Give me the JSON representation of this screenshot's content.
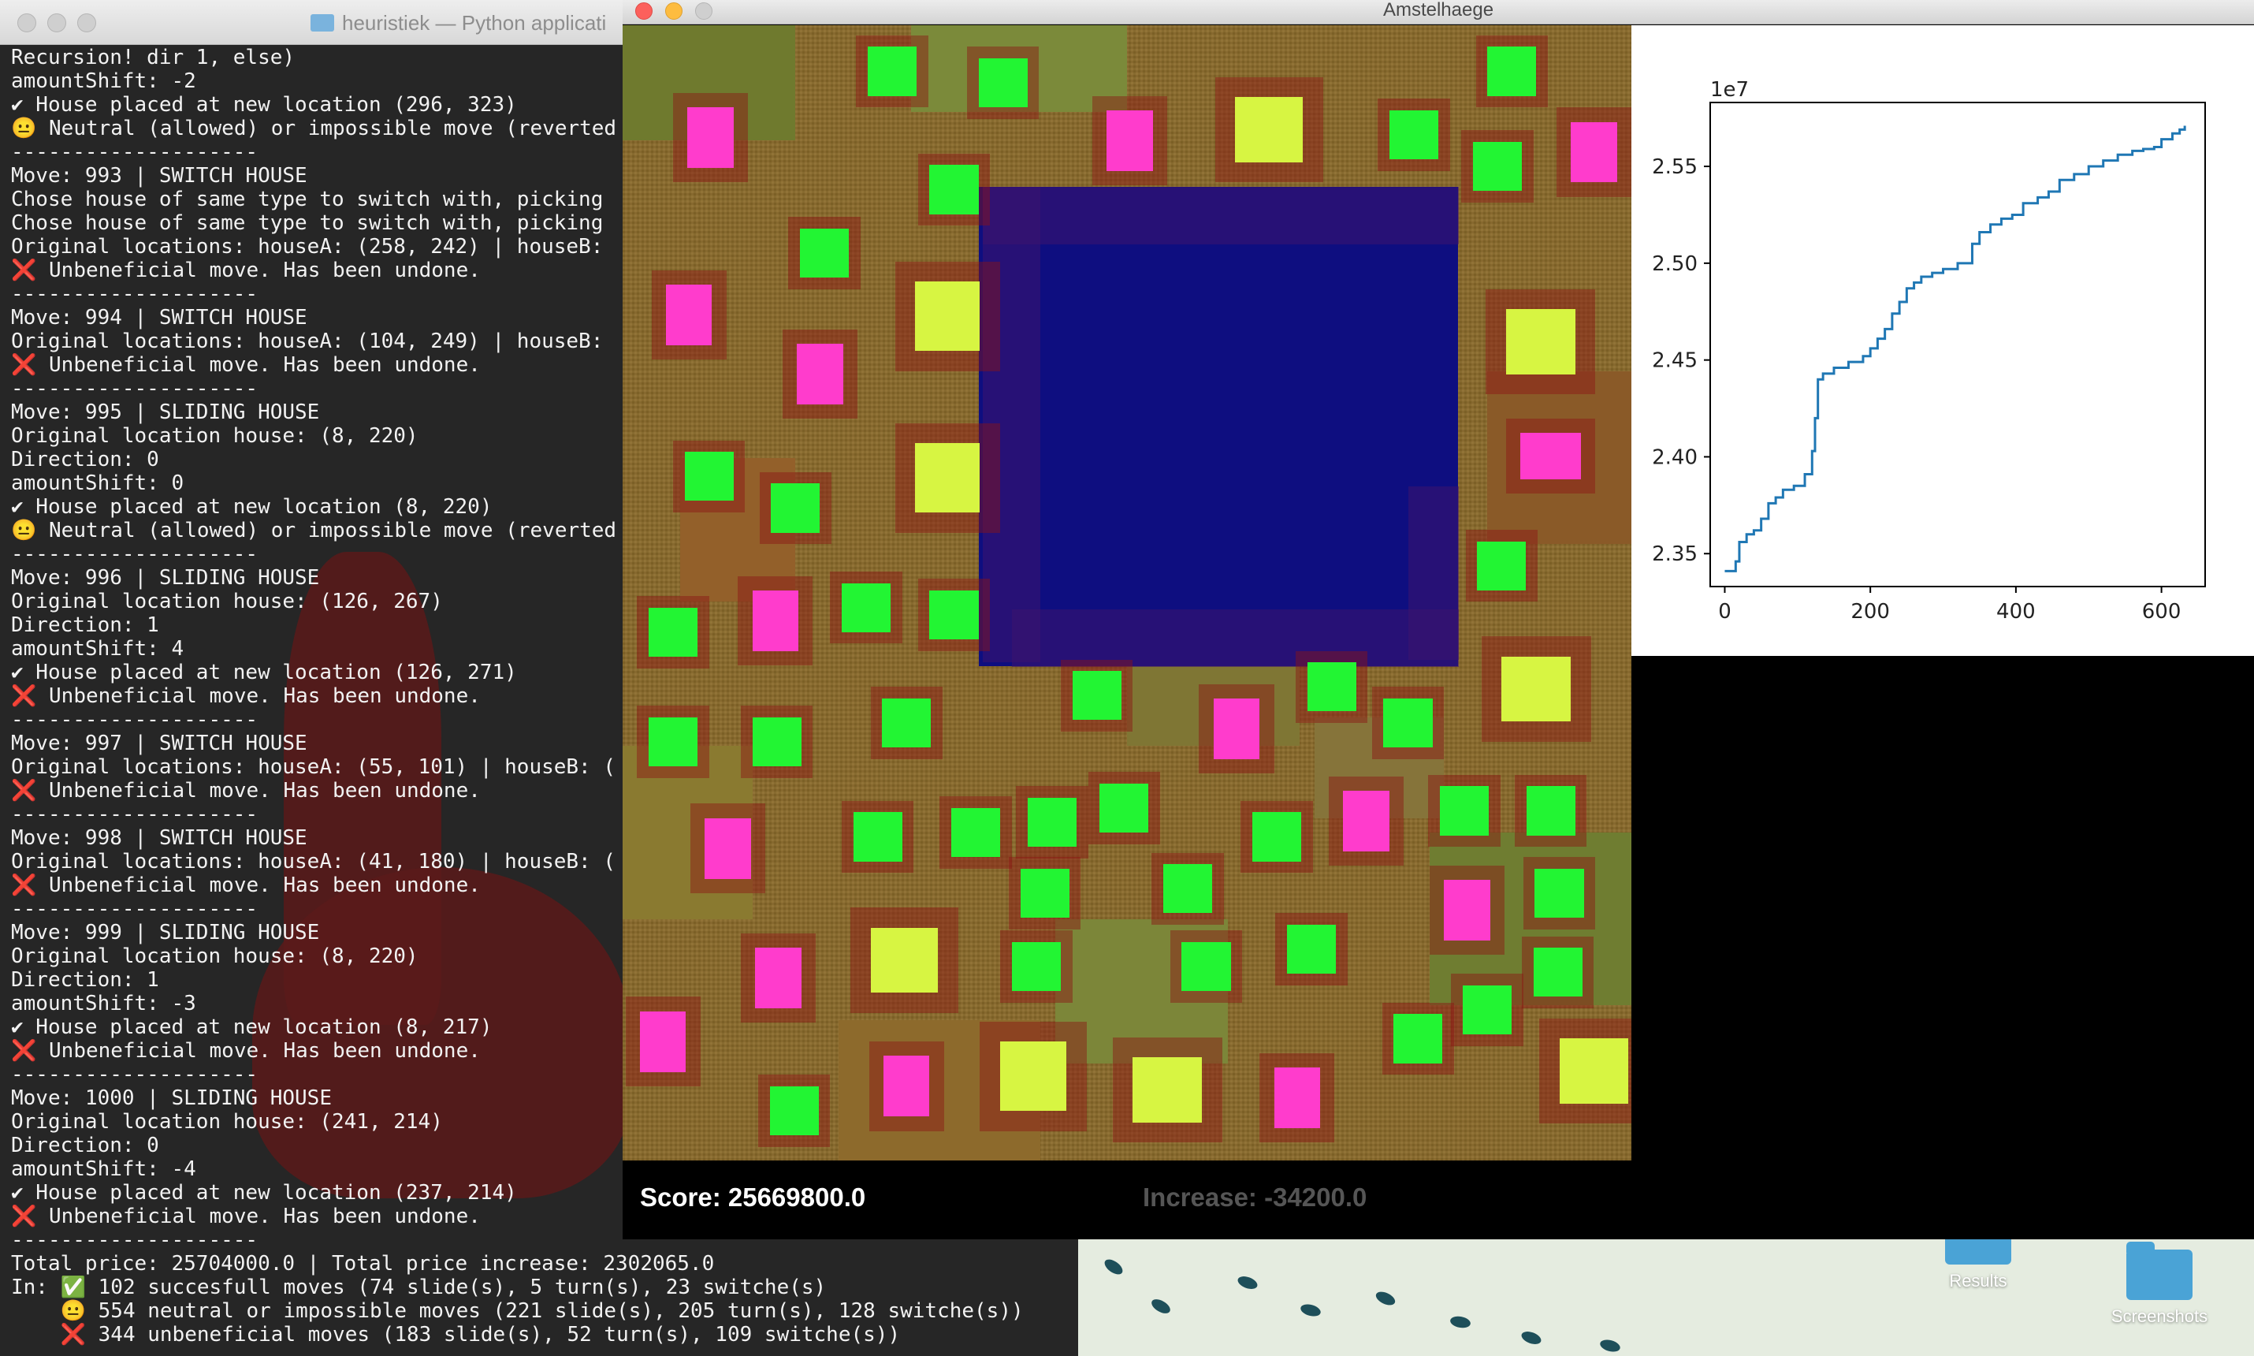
{
  "terminal": {
    "title": "heuristiek — Python applicati",
    "lines": [
      "Recursion! dir 1, else)",
      "amountShift: -2",
      "✔ House placed at new location (296, 323)",
      "😐 Neutral (allowed) or impossible move (reverted",
      "--------------------",
      "Move: 993 | SWITCH HOUSE",
      "Chose house of same type to switch with, picking",
      "Chose house of same type to switch with, picking",
      "Original locations: houseA: (258, 242) | houseB:",
      "❌ Unbeneficial move. Has been undone.",
      "--------------------",
      "Move: 994 | SWITCH HOUSE",
      "Original locations: houseA: (104, 249) | houseB:",
      "❌ Unbeneficial move. Has been undone.",
      "--------------------",
      "Move: 995 | SLIDING HOUSE",
      "Original location house: (8, 220)",
      "Direction: 0",
      "amountShift: 0",
      "✔ House placed at new location (8, 220)",
      "😐 Neutral (allowed) or impossible move (reverted",
      "--------------------",
      "Move: 996 | SLIDING HOUSE",
      "Original location house: (126, 267)",
      "Direction: 1",
      "amountShift: 4",
      "✔ House placed at new location (126, 271)",
      "❌ Unbeneficial move. Has been undone.",
      "--------------------",
      "Move: 997 | SWITCH HOUSE",
      "Original locations: houseA: (55, 101) | houseB: (",
      "❌ Unbeneficial move. Has been undone.",
      "--------------------",
      "Move: 998 | SWITCH HOUSE",
      "Original locations: houseA: (41, 180) | houseB: (",
      "❌ Unbeneficial move. Has been undone.",
      "--------------------",
      "Move: 999 | SLIDING HOUSE",
      "Original location house: (8, 220)",
      "Direction: 1",
      "amountShift: -3",
      "✔ House placed at new location (8, 217)",
      "❌ Unbeneficial move. Has been undone.",
      "--------------------",
      "Move: 1000 | SLIDING HOUSE",
      "Original location house: (241, 214)",
      "Direction: 0",
      "amountShift: -4",
      "✔ House placed at new location (237, 214)",
      "❌ Unbeneficial move. Has been undone.",
      "--------------------",
      "Total price: 25704000.0 | Total price increase: 2302065.0",
      "In: ✅ 102 succesfull moves (74 slide(s), 5 turn(s), 23 switche(s)",
      "    😐 554 neutral or impossible moves (221 slide(s), 205 turn(s), 128 switche(s))",
      "    ❌ 344 unbeneficial moves (183 slide(s), 52 turn(s), 109 switche(s))"
    ]
  },
  "game": {
    "title": "Amstelhaege",
    "score": "Score: 25669800.0",
    "increase": "Increase: -34200.0",
    "colors": {
      "single": "#22f533",
      "bungalow": "#ff3ccc",
      "maison": "#d7f542",
      "water": "#0e0e80"
    }
  },
  "desktop": {
    "icons": [
      {
        "label": "Results"
      },
      {
        "label": "Screenshots"
      }
    ]
  },
  "chart_data": {
    "type": "line",
    "offset_label": "1e7",
    "xlim": [
      -20,
      660
    ],
    "ylim": [
      2.333,
      2.583
    ],
    "xticks": [
      0,
      200,
      400,
      600
    ],
    "yticks": [
      2.35,
      2.4,
      2.45,
      2.5,
      2.55
    ],
    "ytick_labels": [
      "2.35",
      "2.40",
      "2.45",
      "2.50",
      "2.55"
    ],
    "xtick_labels": [
      "0",
      "200",
      "400",
      "600"
    ],
    "series": [
      {
        "color": "#1f77b4",
        "x": [
          0,
          10,
          15,
          20,
          30,
          40,
          50,
          60,
          70,
          80,
          95,
          110,
          120,
          124,
          128,
          135,
          150,
          170,
          190,
          200,
          210,
          220,
          230,
          240,
          250,
          260,
          270,
          285,
          300,
          320,
          340,
          350,
          365,
          380,
          395,
          410,
          430,
          445,
          460,
          480,
          500,
          520,
          540,
          560,
          575,
          590,
          600,
          615,
          625,
          632
        ],
        "y": [
          2.341,
          2.341,
          2.346,
          2.356,
          2.36,
          2.362,
          2.368,
          2.376,
          2.379,
          2.383,
          2.385,
          2.391,
          2.403,
          2.42,
          2.44,
          2.443,
          2.446,
          2.449,
          2.452,
          2.456,
          2.461,
          2.466,
          2.474,
          2.48,
          2.487,
          2.49,
          2.493,
          2.495,
          2.497,
          2.5,
          2.51,
          2.516,
          2.52,
          2.523,
          2.525,
          2.531,
          2.534,
          2.537,
          2.543,
          2.546,
          2.55,
          2.553,
          2.556,
          2.558,
          2.559,
          2.56,
          2.564,
          2.567,
          2.569,
          2.571
        ]
      }
    ]
  }
}
